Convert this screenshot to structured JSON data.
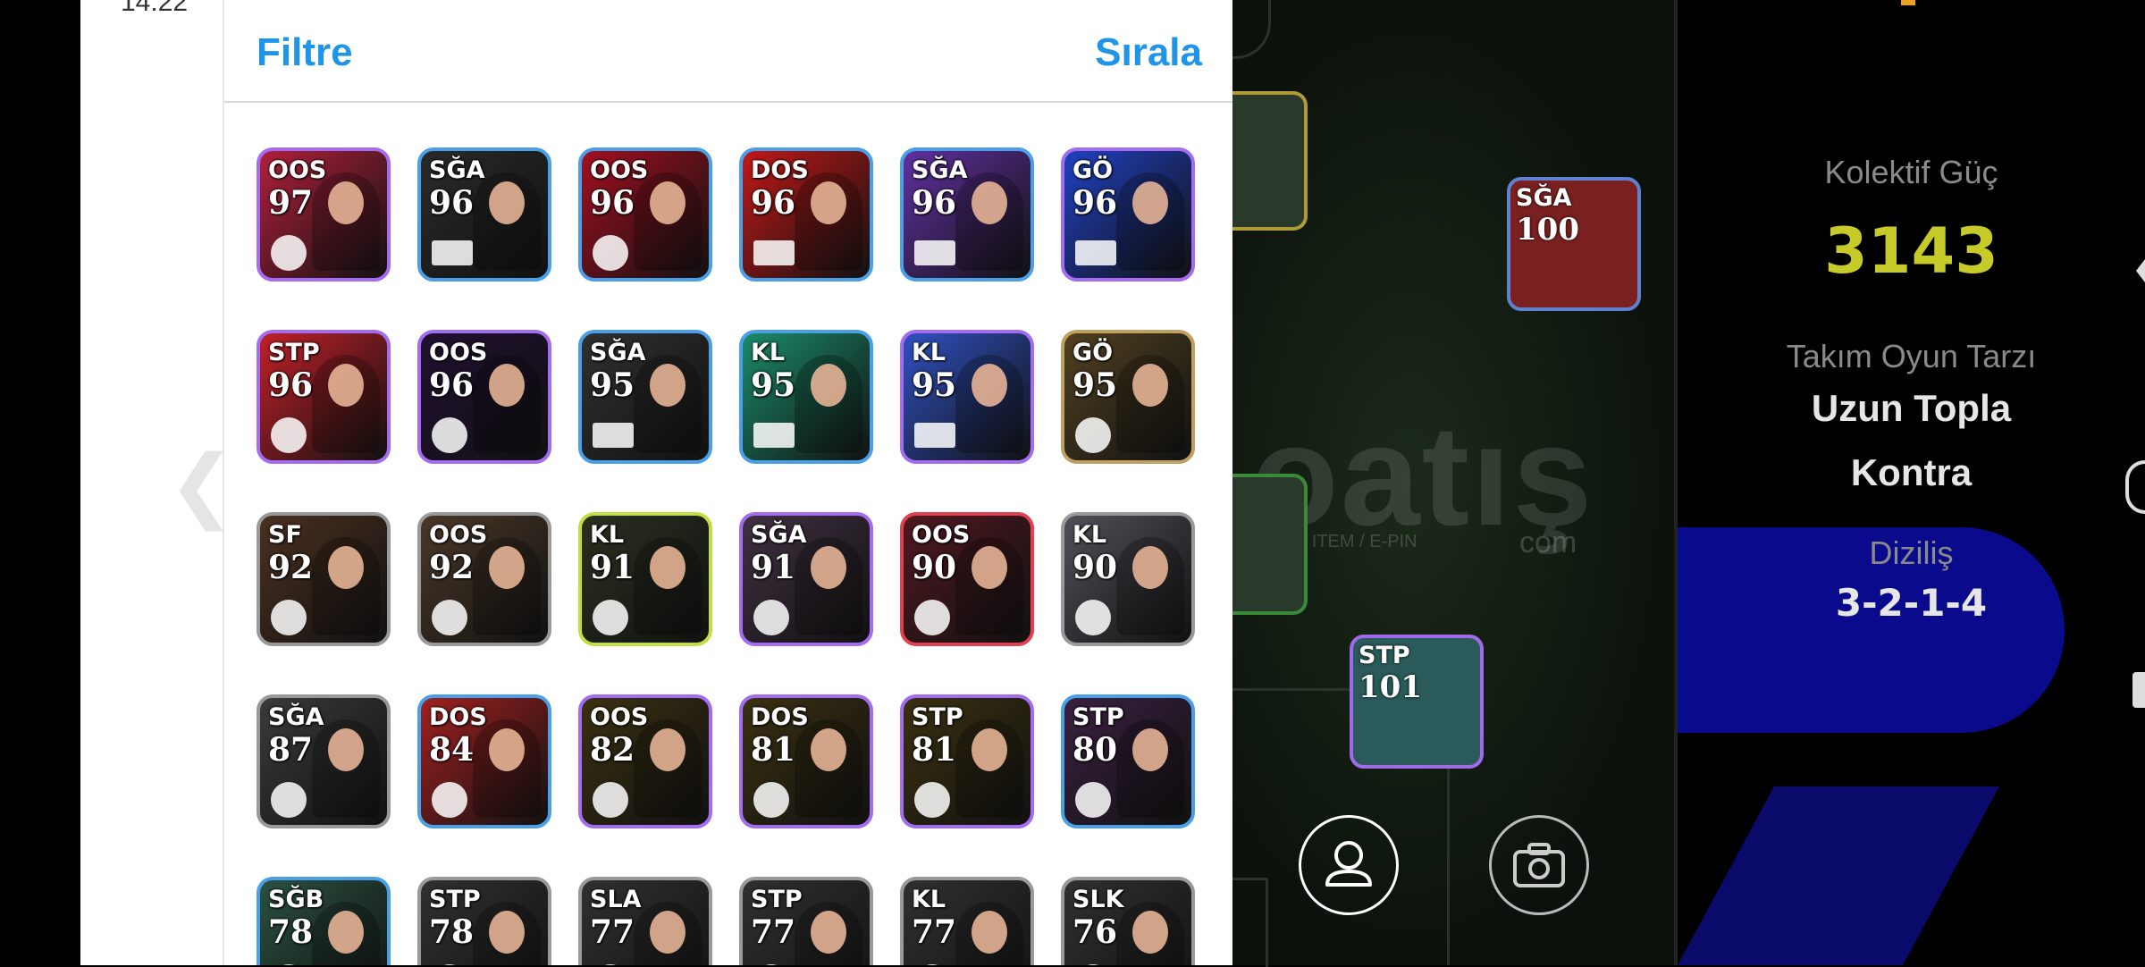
{
  "status": {
    "time": "14:22"
  },
  "header": {
    "filter_label": "Filtre",
    "sort_label": "Sıralа"
  },
  "players": [
    {
      "pos": "OOS",
      "rating": "97",
      "bg": "#b0203a",
      "border": "#a46cf0",
      "badge": "club"
    },
    {
      "pos": "SĞA",
      "rating": "96",
      "bg": "#2a2a2a",
      "border": "#4aa0e8",
      "badge": "flag-ar"
    },
    {
      "pos": "OOS",
      "rating": "96",
      "bg": "#a01020",
      "border": "#4aa0e8",
      "badge": "club"
    },
    {
      "pos": "DOS",
      "rating": "96",
      "bg": "#c01818",
      "border": "#4aa0e8",
      "badge": "flag-es"
    },
    {
      "pos": "SĞA",
      "rating": "96",
      "bg": "#6030a0",
      "border": "#4aa0e8",
      "badge": "flag-eg"
    },
    {
      "pos": "GÖ",
      "rating": "96",
      "bg": "#2040c0",
      "border": "#a46cf0",
      "badge": "flag-ar"
    },
    {
      "pos": "STP",
      "rating": "96",
      "bg": "#c02028",
      "border": "#a46cf0",
      "badge": "club"
    },
    {
      "pos": "OOS",
      "rating": "96",
      "bg": "#201030",
      "border": "#a46cf0",
      "badge": "club"
    },
    {
      "pos": "SĞA",
      "rating": "95",
      "bg": "#303030",
      "border": "#4aa0e8",
      "badge": "flag-es"
    },
    {
      "pos": "KL",
      "rating": "95",
      "bg": "#1a8a6a",
      "border": "#4aa0e8",
      "badge": "flag-es"
    },
    {
      "pos": "KL",
      "rating": "95",
      "bg": "#3050c0",
      "border": "#a46cf0",
      "badge": "flag-si"
    },
    {
      "pos": "GÖ",
      "rating": "95",
      "bg": "#504020",
      "border": "#c0a060",
      "badge": "club"
    },
    {
      "pos": "SF",
      "rating": "92",
      "bg": "#4a3020",
      "border": "#999999",
      "badge": "club"
    },
    {
      "pos": "OOS",
      "rating": "92",
      "bg": "#4a3828",
      "border": "#999999",
      "badge": "club"
    },
    {
      "pos": "KL",
      "rating": "91",
      "bg": "#2a3020",
      "border": "#c0e040",
      "badge": "club"
    },
    {
      "pos": "SĞA",
      "rating": "91",
      "bg": "#403040",
      "border": "#a46cf0",
      "badge": "club"
    },
    {
      "pos": "OOS",
      "rating": "90",
      "bg": "#501820",
      "border": "#e04050",
      "badge": "club"
    },
    {
      "pos": "KL",
      "rating": "90",
      "bg": "#505058",
      "border": "#999999",
      "badge": "club"
    },
    {
      "pos": "SĞA",
      "rating": "87",
      "bg": "#3a3a3a",
      "border": "#999999",
      "badge": "club"
    },
    {
      "pos": "DOS",
      "rating": "84",
      "bg": "#a02020",
      "border": "#4aa0e8",
      "badge": "club"
    },
    {
      "pos": "OOS",
      "rating": "82",
      "bg": "#3a3010",
      "border": "#a46cf0",
      "badge": "club"
    },
    {
      "pos": "DOS",
      "rating": "81",
      "bg": "#3a3010",
      "border": "#a46cf0",
      "badge": "club"
    },
    {
      "pos": "STP",
      "rating": "81",
      "bg": "#3a3010",
      "border": "#a46cf0",
      "badge": "club"
    },
    {
      "pos": "STP",
      "rating": "80",
      "bg": "#3a2040",
      "border": "#4aa0e8",
      "badge": "club"
    },
    {
      "pos": "SĞB",
      "rating": "78",
      "bg": "#2a5040",
      "border": "#4aa0e8",
      "badge": "club"
    },
    {
      "pos": "STP",
      "rating": "78",
      "bg": "#303030",
      "border": "#999999",
      "badge": "club"
    },
    {
      "pos": "SLA",
      "rating": "77",
      "bg": "#303030",
      "border": "#999999",
      "badge": "club"
    },
    {
      "pos": "STP",
      "rating": "77",
      "bg": "#303030",
      "border": "#999999",
      "badge": "club"
    },
    {
      "pos": "KL",
      "rating": "77",
      "bg": "#303030",
      "border": "#999999",
      "badge": "club"
    },
    {
      "pos": "SLK",
      "rating": "76",
      "bg": "#303030",
      "border": "#999999",
      "badge": "club"
    }
  ],
  "pitch": {
    "card_top": {
      "pos": "SĞA",
      "rating": "100"
    },
    "card_bottom": {
      "pos": "STP",
      "rating": "101"
    },
    "watermark": "oatış",
    "watermark_sub": "D... / ITEM / E-PIN",
    "watermark_com": "com"
  },
  "team": {
    "collective_label": "Kolektif Güç",
    "collective_value": "3143",
    "style_label": "Takım Oyun Tarzı",
    "style_value_line1": "Uzun Topla",
    "style_value_line2": "Kontra",
    "formation_label": "Diziliş",
    "formation_value": "3-2-1-4"
  },
  "icons": {
    "back": "chevron-left-icon",
    "profile": "person-icon",
    "camera": "camera-icon"
  }
}
